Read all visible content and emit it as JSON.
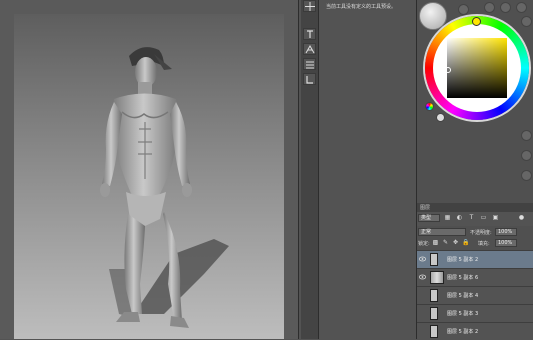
{
  "options_bar": {
    "info_text": "当前工具没有定义的工具预设。"
  },
  "layers_panel": {
    "tab_label": "图层",
    "filter_kind": "类型",
    "blend_mode": "正常",
    "opacity_label": "不透明度:",
    "opacity_value": "100%",
    "lock_label": "锁定:",
    "fill_label": "填充:",
    "fill_value": "100%",
    "layers": [
      {
        "name": "图层 5 副本 2",
        "visible": true,
        "selected": true
      },
      {
        "name": "图层 5 副本 6",
        "visible": true,
        "selected": false
      },
      {
        "name": "图层 5 副本 4",
        "visible": false,
        "selected": false
      },
      {
        "name": "图层 5 副本 3",
        "visible": false,
        "selected": false
      },
      {
        "name": "图层 5 副本 2",
        "visible": false,
        "selected": false
      }
    ]
  },
  "colors": {
    "canvas_top": "#5e5e5e",
    "canvas_bottom": "#bdbdbd",
    "selected_layer": "#6b7b8c",
    "panel_bg": "#535353",
    "current_hue": "#ffe400"
  },
  "icons": [
    "move-icon",
    "paragraph-icon",
    "character-icon",
    "adjust-icon",
    "history-icon",
    "brush-preset-icon",
    "eye-icon"
  ]
}
